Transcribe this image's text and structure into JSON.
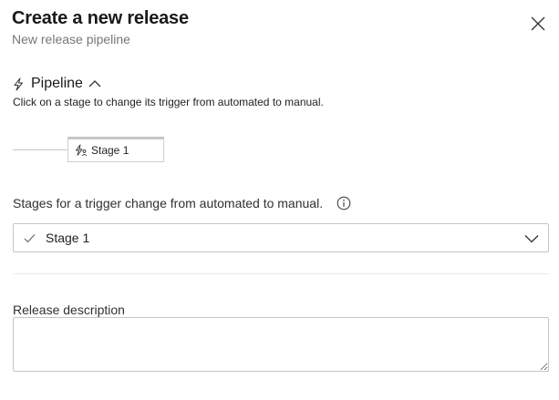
{
  "header": {
    "title": "Create a new release",
    "subtitle": "New release pipeline"
  },
  "pipeline": {
    "section_title": "Pipeline",
    "description": "Click on a stage to change its trigger from automated to manual.",
    "stages": [
      {
        "label": "Stage 1"
      }
    ]
  },
  "trigger_change": {
    "label": "Stages for a trigger change from automated to manual.",
    "selected_value": "Stage 1"
  },
  "release_description": {
    "label": "Release description",
    "value": ""
  },
  "icons": {
    "close": "close-icon",
    "pipeline": "lightning-icon",
    "collapse": "chevron-up-icon",
    "stage": "stage-trigger-icon",
    "info": "info-icon",
    "check": "checkmark-icon",
    "dropdown": "chevron-down-icon"
  }
}
